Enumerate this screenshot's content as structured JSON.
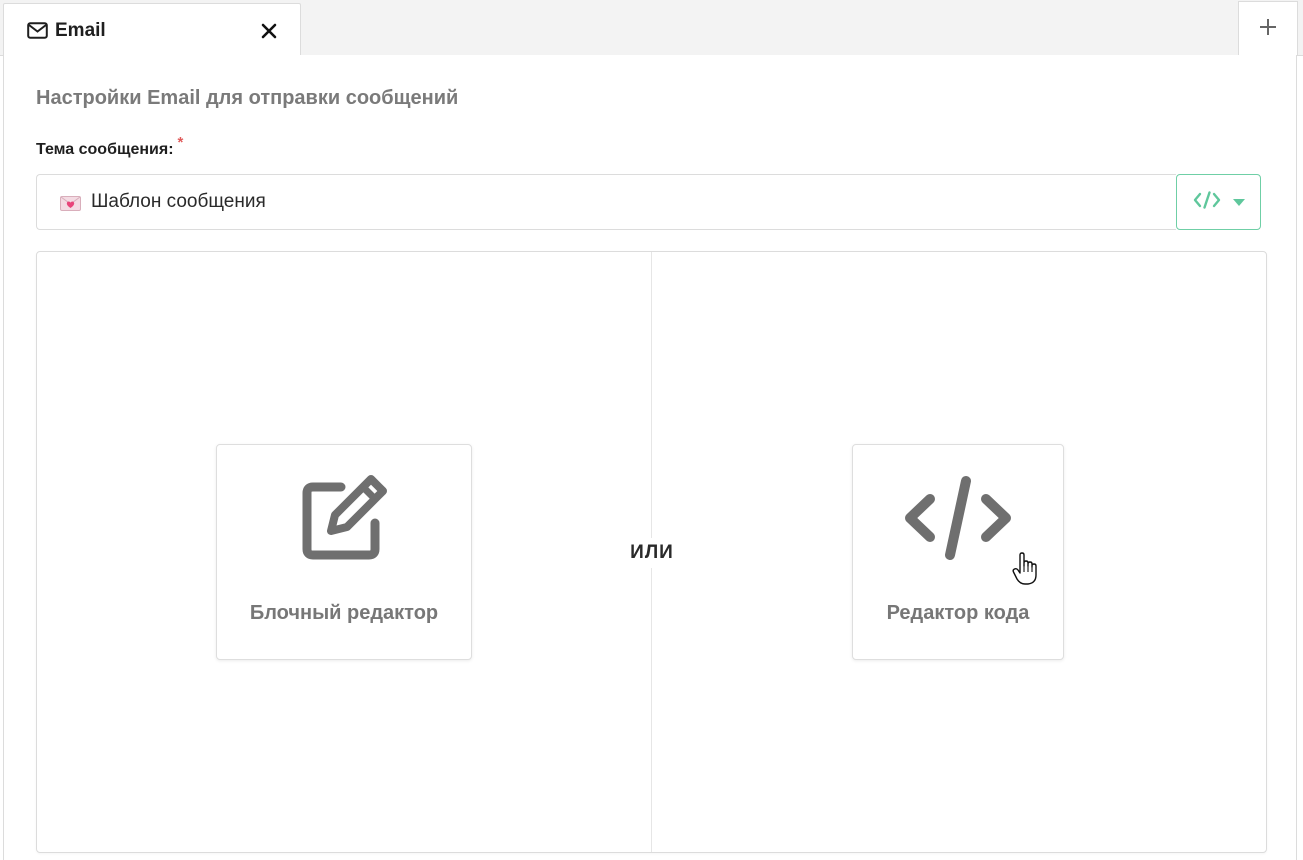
{
  "tabs": {
    "active": {
      "label": "Email",
      "icon": "envelope-icon"
    },
    "close_icon": "close-icon",
    "add_icon": "plus-icon"
  },
  "settings": {
    "title": "Настройки Email для отправки сообщений",
    "subject": {
      "label": "Тема сообщения:",
      "required_mark": "*",
      "value": "Шаблон сообщения",
      "prefix_icon": "love-letter-emoji"
    },
    "insert_dropdown_icon": "code-icon"
  },
  "editor_choice": {
    "separator": "ИЛИ",
    "options": [
      {
        "label": "Блочный редактор",
        "icon": "pencil-square-icon"
      },
      {
        "label": "Редактор кода",
        "icon": "code-icon"
      }
    ]
  },
  "colors": {
    "accent": "#5fc79c",
    "icon_gray": "#6f6f6f",
    "required": "#e05a5a"
  }
}
